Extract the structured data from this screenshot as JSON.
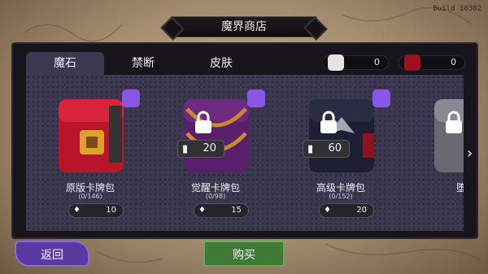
{
  "build": "Build 10302",
  "title": "魔界商店",
  "tabs": [
    {
      "label": "魔石",
      "active": true
    },
    {
      "label": "禁断",
      "active": false
    },
    {
      "label": "皮肤",
      "active": false
    }
  ],
  "currencies": [
    {
      "icon": "card-pack-icon",
      "value": "0"
    },
    {
      "icon": "red-gem-icon",
      "value": "0"
    }
  ],
  "items": [
    {
      "name": "原版卡牌包",
      "count": "(0/146)",
      "price": "10",
      "locked": false,
      "lock_cost": "",
      "color": "#b8142a",
      "accent": "#e0a02c"
    },
    {
      "name": "觉醒卡牌包",
      "count": "(0/98)",
      "price": "15",
      "locked": true,
      "lock_cost": "20",
      "color": "#5a1f6a",
      "accent": "#c98a2c"
    },
    {
      "name": "高级卡牌包",
      "count": "(0/152)",
      "price": "20",
      "locked": true,
      "lock_cost": "60",
      "color": "#1e1f33",
      "accent": "#a8a4b4"
    },
    {
      "name": "堕落",
      "count": "",
      "price": "",
      "locked": true,
      "lock_cost": "",
      "color": "#6a6872",
      "accent": "#c9c6cc"
    }
  ],
  "buttons": {
    "back": "返回",
    "buy": "购买"
  },
  "colors": {
    "panel": "#3c3851",
    "magnifier": "#8a56e6",
    "back": "#5a3aa0",
    "buy": "#3f7a36"
  }
}
